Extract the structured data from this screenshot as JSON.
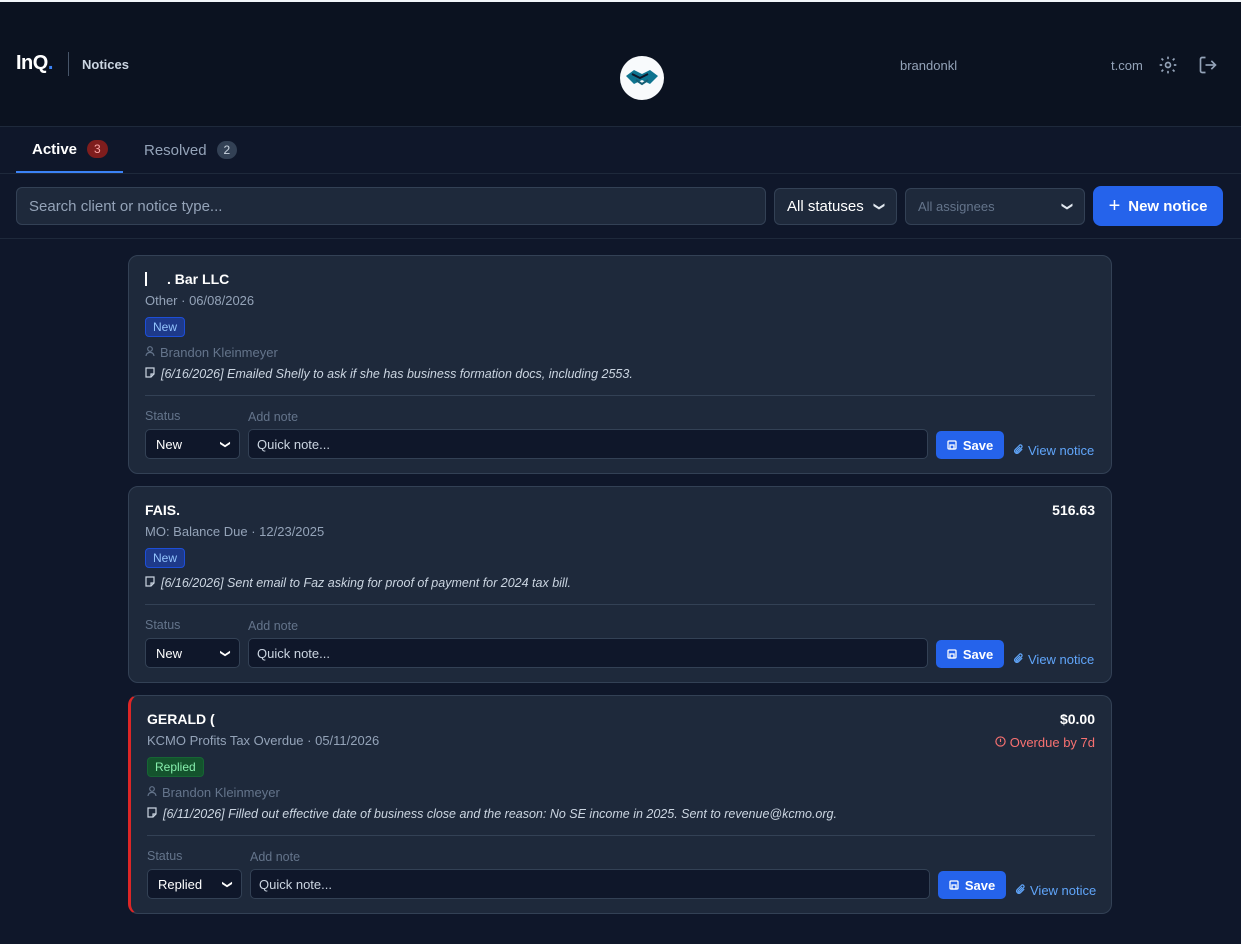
{
  "header": {
    "logo_text": "InQ",
    "logo_dot": ".",
    "section": "Notices",
    "user_name": "brandonkl",
    "user_domain": "t.com",
    "icons": [
      "gear-icon",
      "logout-icon"
    ]
  },
  "tabs": [
    {
      "label": "Active",
      "count": "3"
    },
    {
      "label": "Resolved",
      "count": "2"
    }
  ],
  "toolbar": {
    "search_placeholder": "Search client or notice type...",
    "status_filter": "All statuses",
    "assignee_filter": "All assignees",
    "new_notice_label": "New notice"
  },
  "notices": [
    {
      "client": ". Bar LLC",
      "meta": "Other · 06/08/2026",
      "status_pill": "New",
      "assignee": "Brandon Kleinmeyer",
      "note": "[6/16/2026] Emailed Shelly to ask if she has business formation docs, including 2553.",
      "status_label": "Status",
      "note_label": "Add note",
      "status_value": "New",
      "quick_placeholder": "Quick note...",
      "save_label": "Save",
      "view_label": "View notice"
    },
    {
      "client": "FAIS.",
      "meta": "MO: Balance Due · 12/23/2025",
      "amount": "516.63",
      "status_pill": "New",
      "note": "[6/16/2026] Sent email to Faz asking for proof of payment for 2024 tax bill.",
      "status_label": "Status",
      "note_label": "Add note",
      "status_value": "New",
      "quick_placeholder": "Quick note...",
      "save_label": "Save",
      "view_label": "View notice"
    },
    {
      "client": "GERALD (",
      "meta": "KCMO Profits Tax Overdue · 05/11/2026",
      "amount": "$0.00",
      "overdue": "Overdue by 7d",
      "status_pill": "Replied",
      "assignee": "Brandon Kleinmeyer",
      "note": "[6/11/2026] Filled out effective date of business close and the reason: No SE income in 2025. Sent to revenue@kcmo.org.",
      "status_label": "Status",
      "note_label": "Add note",
      "status_value": "Replied",
      "quick_placeholder": "Quick note...",
      "save_label": "Save",
      "view_label": "View notice"
    }
  ]
}
